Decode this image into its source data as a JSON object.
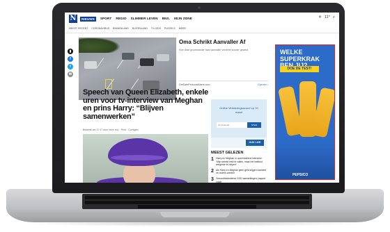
{
  "site": {
    "logo_letter": "N",
    "nav": [
      "NIEUWS",
      "SPORT",
      "REGIO",
      "SLIMMER LEVEN",
      "BNS.",
      "MIJN ZONE"
    ],
    "subnav": [
      "MEEST RECENT",
      "CORONAVIRUS",
      "BINNENLAND",
      "BUITENLAND",
      "TV-GIDS",
      "PUZZELS",
      "MEER"
    ],
    "weather": "11°"
  },
  "share": {
    "facebook": "f",
    "twitter": "t",
    "mail": "✉"
  },
  "ad_top": {
    "title": "Oma Schrikt Aanvaller Af",
    "description": "Hoe deze grootmoeder haar aanvaller verdreef zonder geweld",
    "source": "GetSafePersonalAlarm.com",
    "open_label": "Openen"
  },
  "article": {
    "headline": "Speech van Queen Elizabeth, enkele uren voor tv-interview van Meghan en prins Harry: “Blijven samenwerken”",
    "byline": "Bewerkt om 17:17 door onze red. · Print · Corrigeer"
  },
  "ad_mid": {
    "text": "Online Verkiezingsavond op 10 maart",
    "input_placeholder": "Je postcode",
    "go_label": "STEM",
    "cta": "KIJK LIVE"
  },
  "most_read": {
    "title": "MEEST GELEZEN",
    "items": [
      {
        "num": "1",
        "text": "Harry en Meghan in opzienbarend interview: “Mijn wereld leek te vallen, maar het instituut weigerde te helpen”"
      },
      {
        "num": "2",
        "text": "Als Harry en Meghan geen geld krijgen wanneer ze ouders worden"
      },
      {
        "num": "3",
        "text": "Gezondheidsdienst GGD aanstellingen (rapport volgt)"
      }
    ]
  },
  "banner": {
    "line1": "WELKE",
    "line2": "SUPERKRAK",
    "line3": "BEN JIJ?",
    "cta": "DOE DE TEST!",
    "brand": "PEPSICO",
    "border_color": "#e1251b",
    "bg_color": "#2d6bc9"
  }
}
